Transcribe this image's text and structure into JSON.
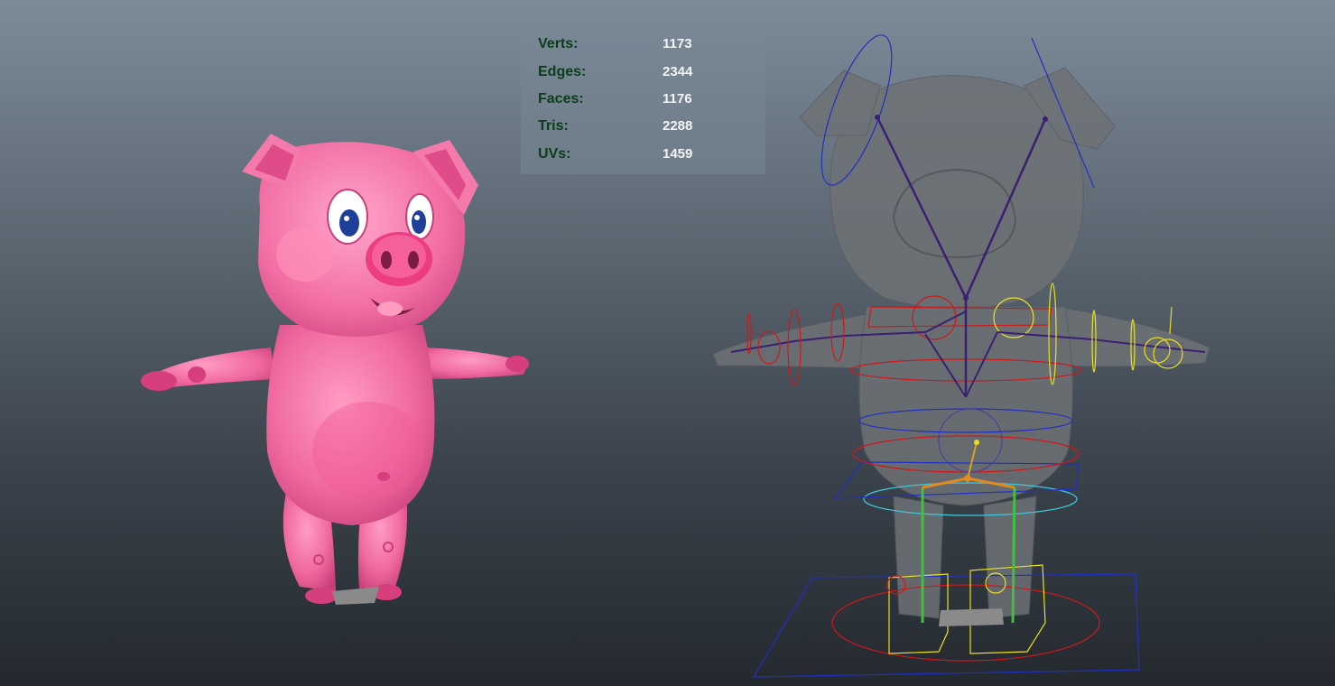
{
  "viewport": {
    "scene_objects": [
      {
        "name": "pig-textured-model",
        "shading": "textured"
      },
      {
        "name": "pig-rigged-model",
        "shading": "x-ray with rig controls"
      }
    ]
  },
  "hud": {
    "stats": [
      {
        "label": "Verts:",
        "value": "1173"
      },
      {
        "label": "Edges:",
        "value": "2344"
      },
      {
        "label": "Faces:",
        "value": "1176"
      },
      {
        "label": "Tris:",
        "value": "2288"
      },
      {
        "label": "UVs:",
        "value": "1459"
      }
    ]
  },
  "colors": {
    "pig_pink": "#f06aa0",
    "pig_dark_pink": "#d63e7e",
    "xray_gray": "#6e7276",
    "rig_red": "#d01818",
    "rig_blue": "#2030c0",
    "rig_yellow": "#e8e020",
    "rig_cyan": "#40c8d8",
    "rig_green": "#40c040",
    "hud_label": "#0c3d1a"
  }
}
